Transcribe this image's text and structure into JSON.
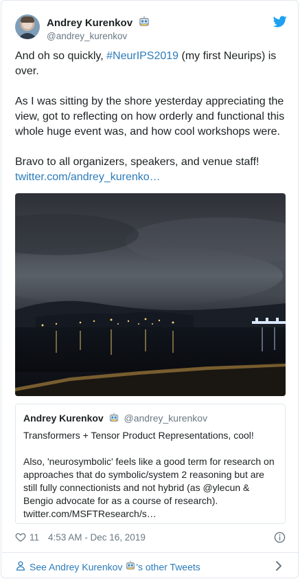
{
  "author": {
    "name": "Andrey Kurenkov",
    "handle": "@andrey_kurenkov"
  },
  "tweet": {
    "line1_pre": "And oh so quickly, ",
    "hashtag": "#NeurIPS2019",
    "line1_post": " (my first Neurips) is over.",
    "para2": "As I was sitting by the shore yesterday appreciating the view, got to reflecting on how orderly and functional this whole huge event was, and how cool workshops were.",
    "para3": "Bravo to all organizers, speakers, and venue staff!",
    "link": "twitter.com/andrey_kurenko…"
  },
  "quoted": {
    "name": "Andrey Kurenkov",
    "handle": "@andrey_kurenkov",
    "para1": "Transformers + Tensor Product Representations, cool!",
    "para2": "Also, 'neurosymbolic' feels like a good term for research on approaches that do symbolic/system 2 reasoning but are still fully connectionists and not hybrid (as @ylecun & Bengio advocate for as a course of research).",
    "link": "twitter.com/MSFTResearch/s…"
  },
  "meta": {
    "likes": "11",
    "timestamp": "4:53 AM - Dec 16, 2019"
  },
  "footer": {
    "pre": "See Andrey Kurenkov ",
    "post": "'s other Tweets"
  },
  "colors": {
    "link": "#2b7bb9",
    "twitter_blue": "#1da1f2",
    "secondary_text": "#697882",
    "border": "#e1e8ed"
  }
}
